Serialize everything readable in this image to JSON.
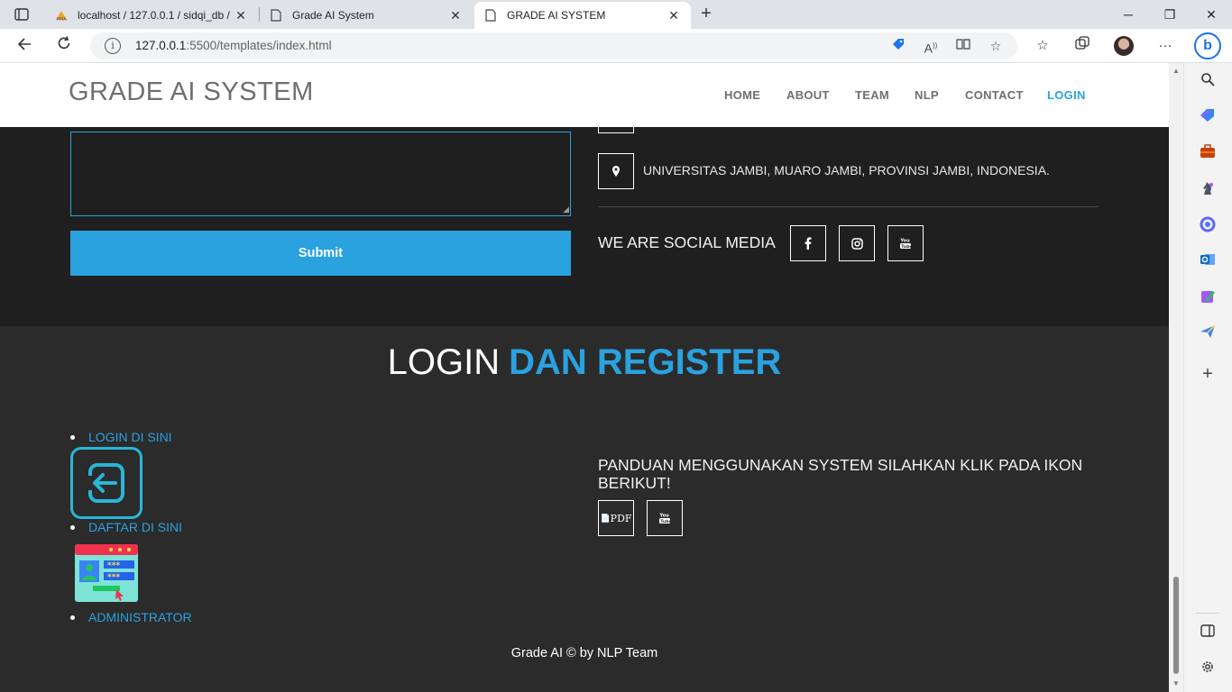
{
  "browser": {
    "tabs": [
      {
        "title": "localhost / 127.0.0.1 / sidqi_db / ",
        "icon": "phpmyadmin-icon",
        "active": false
      },
      {
        "title": "Grade AI System",
        "icon": "page-icon",
        "active": false
      },
      {
        "title": "GRADE AI SYSTEM",
        "icon": "page-icon",
        "active": true
      }
    ],
    "url_host": "127.0.0.1",
    "url_path": ":5500/templates/index.html",
    "bing_label": "b"
  },
  "site": {
    "logo": "GRADE AI SYSTEM",
    "nav": [
      {
        "label": "HOME",
        "active": false
      },
      {
        "label": "ABOUT",
        "active": false
      },
      {
        "label": "TEAM",
        "active": false
      },
      {
        "label": "NLP",
        "active": false
      },
      {
        "label": "CONTACT",
        "active": false
      },
      {
        "label": "LOGIN",
        "active": true
      }
    ]
  },
  "contact": {
    "message_value": "",
    "submit_label": "Submit",
    "address": "UNIVERSITAS JAMBI, MUARO JAMBI, PROVINSI JAMBI, INDONESIA.",
    "social_title": "WE ARE SOCIAL MEDIA",
    "social_icons": [
      "facebook-icon",
      "instagram-icon",
      "youtube-icon"
    ]
  },
  "login": {
    "title_main": "LOGIN",
    "title_accent": "DAN REGISTER",
    "links": [
      {
        "label": "LOGIN DI SINI"
      },
      {
        "label": "DAFTAR DI SINI"
      },
      {
        "label": "ADMINISTRATOR"
      }
    ],
    "guide_text": "PANDUAN MENGGUNAKAN SYSTEM SILAHKAN KLIK PADA IKON BERIKUT!",
    "guide_buttons": [
      {
        "icon": "pdf-icon",
        "label": "PDF"
      },
      {
        "icon": "youtube-icon",
        "label": ""
      }
    ]
  },
  "footer": {
    "credit": "Grade AI © by NLP Team"
  },
  "colors": {
    "accent": "#2aa2e0",
    "dark_section": "#1f1f1f",
    "login_section": "#2b2b2b"
  }
}
